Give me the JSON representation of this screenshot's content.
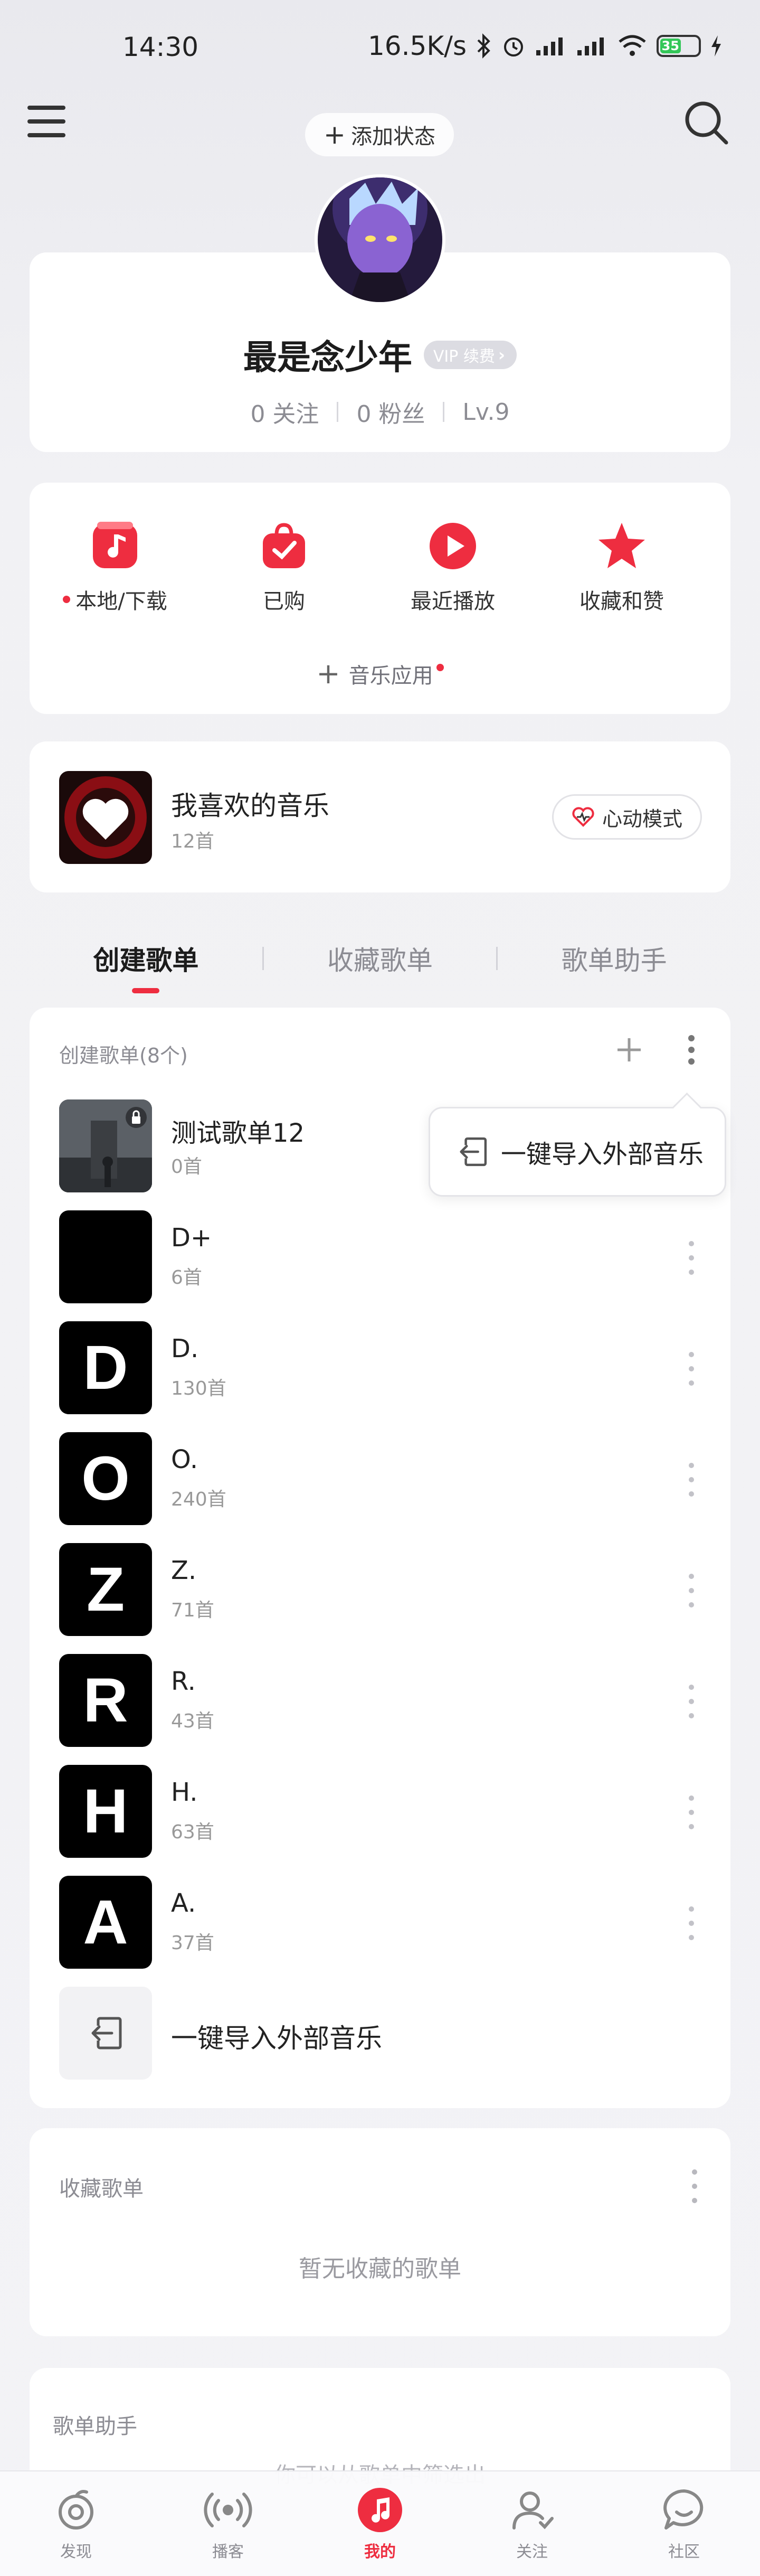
{
  "status_bar": {
    "time": "14:30",
    "speed": "16.5K/s",
    "battery": "35"
  },
  "header": {
    "add_status": "添加状态"
  },
  "profile": {
    "username": "最是念少年",
    "vip_label": "VIP 续费",
    "following": "0 关注",
    "fans": "0 粉丝",
    "level": "Lv.9"
  },
  "quick_actions": [
    {
      "label": "本地/下载",
      "icon": "music-note-icon",
      "dot": true
    },
    {
      "label": "已购",
      "icon": "shopping-bag-icon",
      "dot": false
    },
    {
      "label": "最近播放",
      "icon": "play-icon",
      "dot": false
    },
    {
      "label": "收藏和赞",
      "icon": "star-icon",
      "dot": false
    }
  ],
  "music_apps_label": "音乐应用",
  "liked": {
    "title": "我喜欢的音乐",
    "count": "12首",
    "heart_mode": "心动模式"
  },
  "tabs": [
    "创建歌单",
    "收藏歌单",
    "歌单助手"
  ],
  "playlists_section": {
    "header": "创建歌单(8个)",
    "items": [
      {
        "name": "测试歌单12",
        "count": "0首",
        "cover_letter": ""
      },
      {
        "name": "D+",
        "count": "6首",
        "cover_letter": ""
      },
      {
        "name": "D.",
        "count": "130首",
        "cover_letter": "D"
      },
      {
        "name": "O.",
        "count": "240首",
        "cover_letter": "O"
      },
      {
        "name": "Z.",
        "count": "71首",
        "cover_letter": "Z"
      },
      {
        "name": "R.",
        "count": "43首",
        "cover_letter": "R"
      },
      {
        "name": "H.",
        "count": "63首",
        "cover_letter": "H"
      },
      {
        "name": "A.",
        "count": "37首",
        "cover_letter": "A"
      }
    ],
    "import_label": "一键导入外部音乐"
  },
  "popup": {
    "label": "一键导入外部音乐"
  },
  "collected": {
    "title": "收藏歌单",
    "empty": "暂无收藏的歌单"
  },
  "assistant": {
    "title": "歌单助手",
    "hint": "你可以从歌单中筛选出"
  },
  "bottom_nav": [
    {
      "label": "发现",
      "icon": "discover-icon"
    },
    {
      "label": "播客",
      "icon": "podcast-icon"
    },
    {
      "label": "我的",
      "icon": "my-music-icon",
      "active": true
    },
    {
      "label": "关注",
      "icon": "follow-icon"
    },
    {
      "label": "社区",
      "icon": "community-icon"
    }
  ],
  "colors": {
    "accent": "#ee2d40",
    "background": "#f3f3f6"
  }
}
